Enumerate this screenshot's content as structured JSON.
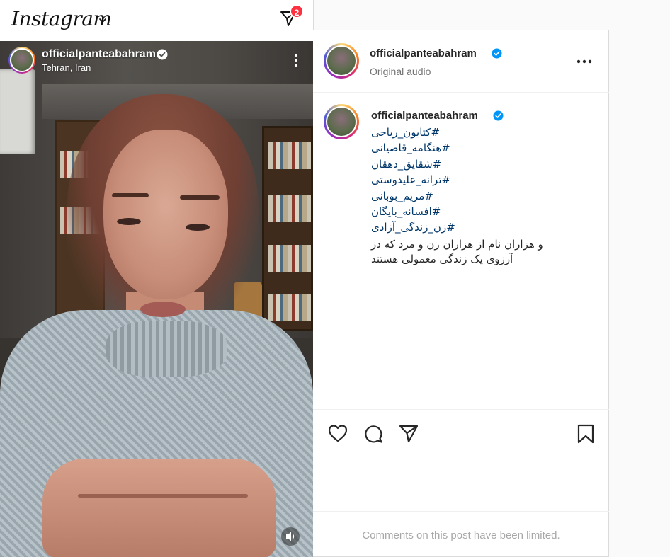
{
  "app": {
    "logo_text": "Instagram",
    "notification_count": "2",
    "icons": {
      "logo_dropdown": "chevron-down-icon",
      "direct": "paper-plane-icon"
    }
  },
  "video": {
    "username": "officialpanteabahram",
    "location": "Tehran, Iran",
    "icons": {
      "verified": "verified-badge-icon",
      "more": "more-vertical-icon",
      "sound": "speaker-icon"
    }
  },
  "post": {
    "header": {
      "username": "officialpanteabahram",
      "audio": "Original audio"
    },
    "caption": {
      "username": "officialpanteabahram",
      "hashtags": [
        "#کتایون_ریاحی",
        "#هنگامه_قاضیانی",
        "#شقایق_دهقان",
        "#ترانه_علیدوستی",
        "#مریم_بوبانی",
        "#افسانه_بایگان",
        "#زن_زندگی_آزادی"
      ],
      "text": "و هزاران نام از هزاران زن و مرد که در آرزوی یک زندگی معمولی هستند"
    },
    "comments_notice": "Comments on this post have been limited.",
    "icons": {
      "like": "heart-icon",
      "comment": "comment-bubble-icon",
      "share": "paper-plane-icon",
      "save": "bookmark-icon",
      "more": "more-horizontal-icon"
    },
    "colors": {
      "hashtag": "#00376b",
      "verified": "#0095f6",
      "badge": "#ff3040"
    }
  }
}
